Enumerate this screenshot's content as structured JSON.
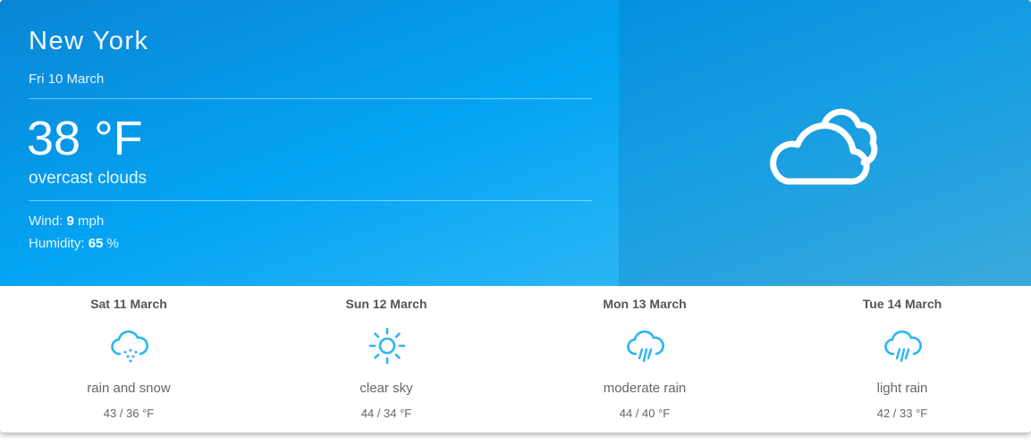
{
  "current": {
    "city": "New York",
    "date": "Fri 10 March",
    "temperature": "38 °F",
    "description": "overcast clouds",
    "wind_label": "Wind:",
    "wind_value": "9",
    "wind_unit": "mph",
    "humidity_label": "Humidity:",
    "humidity_value": "65",
    "humidity_unit": "%",
    "icon": "overcast-clouds-icon"
  },
  "forecast": [
    {
      "day": "Sat 11 March",
      "description": "rain and snow",
      "temps": "43 / 36 °F",
      "icon": "rain-snow-icon"
    },
    {
      "day": "Sun 12 March",
      "description": "clear sky",
      "temps": "44 / 34 °F",
      "icon": "sun-icon"
    },
    {
      "day": "Mon 13 March",
      "description": "moderate rain",
      "temps": "44 / 40 °F",
      "icon": "rain-icon"
    },
    {
      "day": "Tue 14 March",
      "description": "light rain",
      "temps": "42 / 33 °F",
      "icon": "rain-icon"
    }
  ],
  "colors": {
    "hero_blue": "#03a4f3",
    "icon_blue": "#29b6f6",
    "text_gray": "#666666"
  }
}
